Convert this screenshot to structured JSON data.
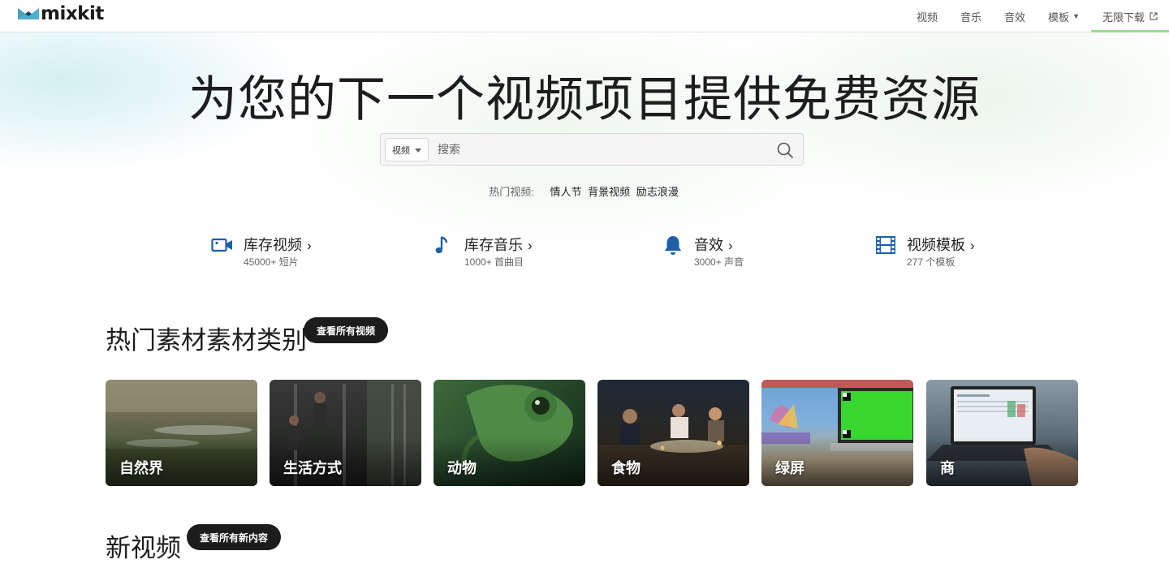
{
  "header": {
    "logo_text": "mixkit",
    "nav": [
      {
        "label": "视频"
      },
      {
        "label": "音乐"
      },
      {
        "label": "音效"
      },
      {
        "label": "模板"
      },
      {
        "label": "无限下载"
      }
    ]
  },
  "hero": {
    "title": "为您的下一个视频项目提供免费资源",
    "search": {
      "type_label": "视频",
      "placeholder": "搜索"
    },
    "trending": {
      "label": "热门视频:",
      "links": [
        "情人节",
        "背景视频",
        "励志浪漫"
      ]
    }
  },
  "categories": [
    {
      "title": "库存视频",
      "sub": "45000+ 短片",
      "icon": "video-camera-icon"
    },
    {
      "title": "库存音乐",
      "sub": "1000+ 首曲目",
      "icon": "music-note-icon"
    },
    {
      "title": "音效",
      "sub": "3000+ 声音",
      "icon": "bell-icon"
    },
    {
      "title": "视频模板",
      "sub": "277 个模板",
      "icon": "film-strip-icon"
    }
  ],
  "popular": {
    "title": "热门素材素材类别",
    "button": "查看所有视频",
    "tiles": [
      {
        "label": "自然界"
      },
      {
        "label": "生活方式"
      },
      {
        "label": "动物"
      },
      {
        "label": "食物"
      },
      {
        "label": "绿屏"
      },
      {
        "label": "商"
      }
    ]
  },
  "new_videos": {
    "title": "新视频",
    "button": "查看所有新内容"
  },
  "colors": {
    "accent_green": "#9adf8c",
    "icon_blue": "#1d5fa8",
    "dark_button": "#1c1c1c"
  }
}
